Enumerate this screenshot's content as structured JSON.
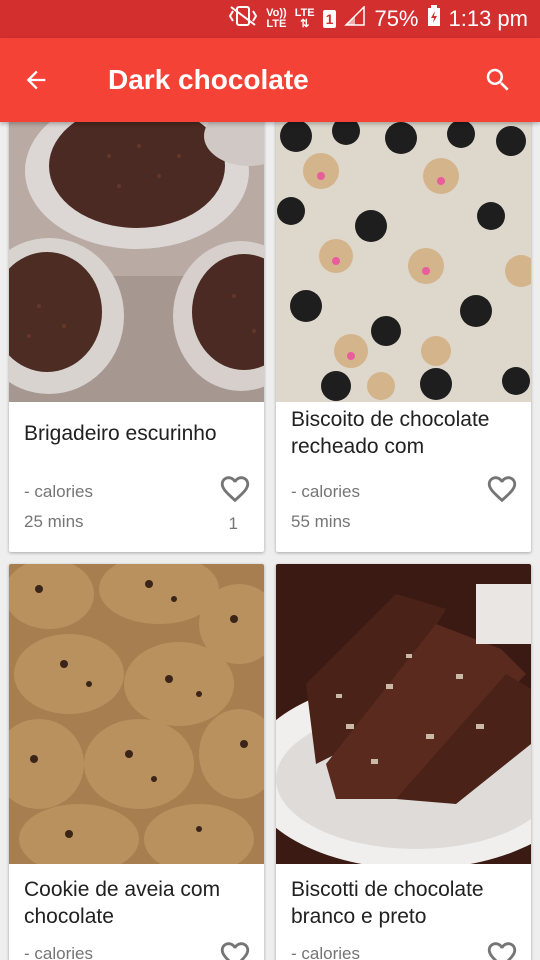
{
  "status": {
    "volte": "Vo))",
    "lte_small": "LTE",
    "lte": "LTE",
    "sim": "1",
    "battery": "75%",
    "time": "1:13 pm"
  },
  "appbar": {
    "title": "Dark chocolate"
  },
  "recipes": [
    {
      "name": "Brigadeiro escurinho",
      "calories": "- calories",
      "time": "25 mins",
      "likes": "1"
    },
    {
      "name": "Biscoito de chocolate recheado com",
      "calories": "- calories",
      "time": "55 mins",
      "likes": ""
    },
    {
      "name": "Cookie de aveia com chocolate",
      "calories": "- calories",
      "time": "",
      "likes": ""
    },
    {
      "name": "Biscotti de chocolate branco e preto",
      "calories": "- calories",
      "time": "",
      "likes": ""
    }
  ],
  "colors": {
    "appbar": "#f44336",
    "statusbar": "#d32f2f"
  }
}
